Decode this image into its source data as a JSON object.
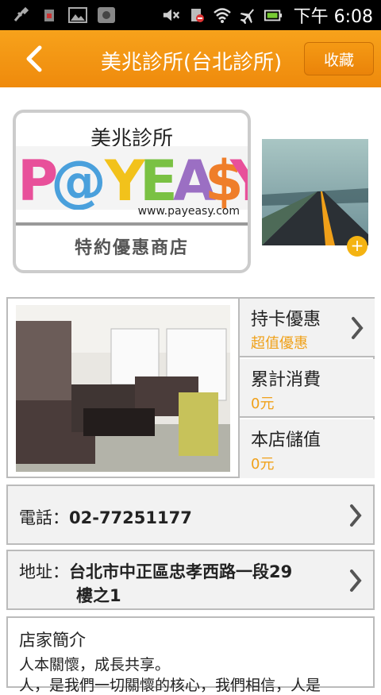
{
  "status_bar": {
    "time": "下午 6:08",
    "left_icons": [
      "usb-icon",
      "sim-icon",
      "gallery-icon",
      "screenshot-icon"
    ],
    "right_icons": [
      "mute-icon",
      "no-sim-icon",
      "wifi-icon",
      "airplane-icon",
      "battery-icon"
    ]
  },
  "header": {
    "title": "美兆診所(台北診所)",
    "favorite_label": "收藏",
    "accent": "#f39a12"
  },
  "logo": {
    "store_name": "美兆診所",
    "brand": "P@YEASY",
    "url": "www.payeasy.com",
    "subtitle": "特約優惠商店"
  },
  "info_cells": [
    {
      "label": "持卡優惠",
      "value": "超值優惠"
    },
    {
      "label": "累計消費",
      "value": "0元"
    },
    {
      "label": "本店儲值",
      "value": "0元"
    }
  ],
  "phone": {
    "label": "電話：",
    "value": "02-77251177"
  },
  "address": {
    "label": "地址：",
    "value_line1": "台北市中正區忠孝西路一段29",
    "value_line2": "樓之1"
  },
  "intro": {
    "title": "店家簡介",
    "line1": "人本關懷，成長共享。",
    "line2": "人，是我們一切關懷的核心，我們相信，人是"
  },
  "colors": {
    "value_text": "#f0a11a",
    "border": "#bbbbbb"
  }
}
